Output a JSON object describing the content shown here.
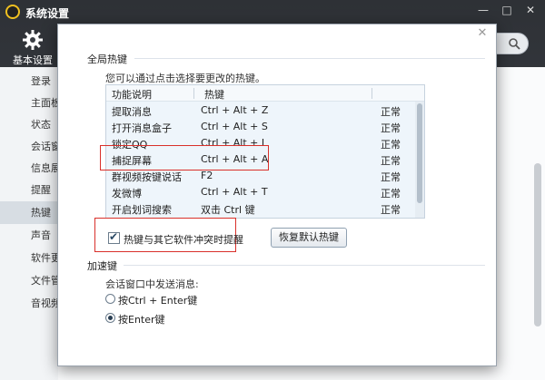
{
  "app": {
    "title": "系统设置"
  },
  "toolbar": {
    "basic_settings_label": "基本设置"
  },
  "sidebar": {
    "items": [
      {
        "label": "登录"
      },
      {
        "label": "主面板"
      },
      {
        "label": "状态"
      },
      {
        "label": "会话窗口"
      },
      {
        "label": "信息展示"
      },
      {
        "label": "提醒"
      },
      {
        "label": "热键",
        "active": true
      },
      {
        "label": "声音"
      },
      {
        "label": "软件更新"
      },
      {
        "label": "文件管理"
      },
      {
        "label": "音视频"
      }
    ]
  },
  "dialog": {
    "global_hotkeys": {
      "title": "全局热键",
      "hint": "您可以通过点击选择要更改的热键。",
      "columns": {
        "function": "功能说明",
        "hotkey": "热键"
      },
      "rows": [
        {
          "function": "提取消息",
          "hotkey": "Ctrl + Alt + Z",
          "status": "正常"
        },
        {
          "function": "打开消息盒子",
          "hotkey": "Ctrl + Alt + S",
          "status": "正常"
        },
        {
          "function": "锁定QQ",
          "hotkey": "Ctrl + Alt + L",
          "status": "正常"
        },
        {
          "function": "捕捉屏幕",
          "hotkey": "Ctrl + Alt + A",
          "status": "正常"
        },
        {
          "function": "群视频按键说话",
          "hotkey": "F2",
          "status": "正常"
        },
        {
          "function": "发微博",
          "hotkey": "Ctrl + Alt + T",
          "status": "正常"
        },
        {
          "function": "开启划词搜索",
          "hotkey": "双击 Ctrl 键",
          "status": "正常"
        }
      ],
      "conflict_checkbox_label": "热键与其它软件冲突时提醒",
      "conflict_checkbox_checked": true,
      "restore_button_label": "恢复默认热键"
    },
    "accelerators": {
      "title": "加速键",
      "send_message_label": "会话窗口中发送消息:",
      "options": [
        {
          "label": "按Ctrl + Enter键",
          "selected": false
        },
        {
          "label": "按Enter键",
          "selected": true
        }
      ]
    }
  },
  "colors": {
    "highlight_box": "#d9302a",
    "table_bg": "#eef5fb"
  }
}
